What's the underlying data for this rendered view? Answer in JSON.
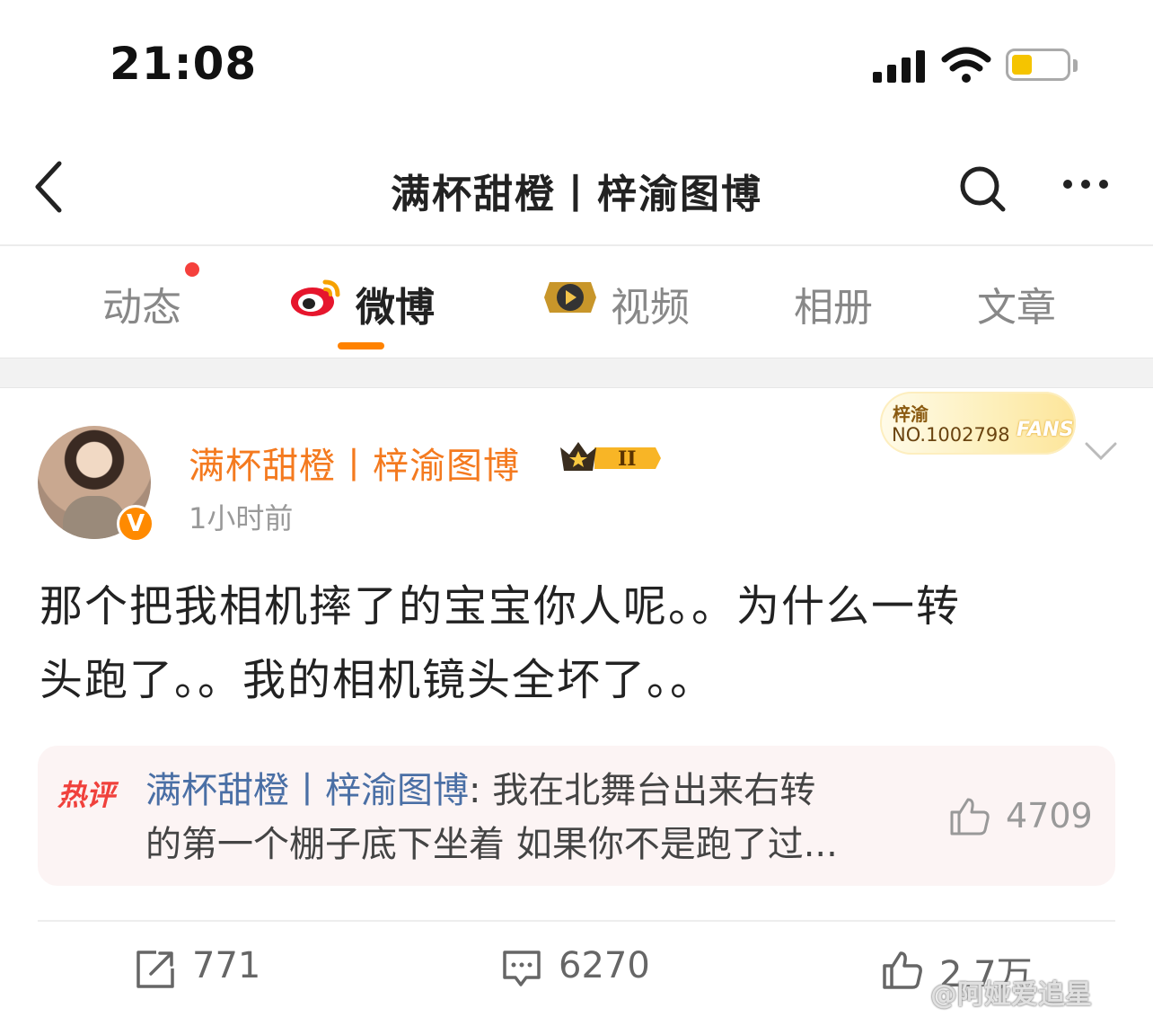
{
  "status_bar": {
    "time": "21:08"
  },
  "nav": {
    "title": "满杯甜橙丨梓渝图博"
  },
  "tabs": [
    {
      "label": "动态",
      "has_dot": true
    },
    {
      "label": "微博",
      "active": true
    },
    {
      "label": "视频"
    },
    {
      "label": "相册"
    },
    {
      "label": "文章"
    }
  ],
  "fans_badge": {
    "name": "梓渝",
    "number": "NO.1002798",
    "tag": "FANS"
  },
  "post": {
    "author": "满杯甜橙丨梓渝图博",
    "level_badge": "II",
    "verified_mark": "V",
    "time": "1小时前",
    "text_line1": "那个把我相机摔了的宝宝你人呢。。为什么一转",
    "text_line2": "头跑了。。我的相机镜头全坏了。。"
  },
  "hot_comment": {
    "label": "热评",
    "author": "满杯甜橙丨梓渝图博",
    "text_line1": ": 我在北舞台出来右转",
    "text_line2": "的第一个棚子底下坐着 如果你不是跑了过...",
    "likes": "4709"
  },
  "actions": {
    "reposts": "771",
    "comments": "6270",
    "likes": "2.7万"
  },
  "watermark": "@阿娅爱追星",
  "colors": {
    "accent": "#ff8200",
    "author": "#f47a1f",
    "hot_red": "#f0413c",
    "link_blue": "#4a6fa5"
  }
}
